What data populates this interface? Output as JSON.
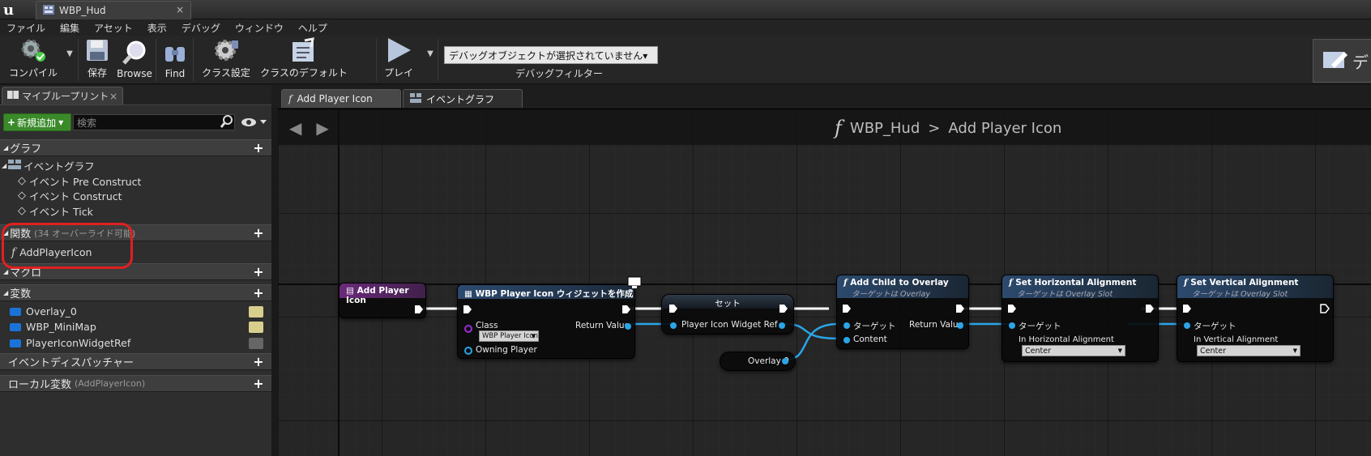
{
  "app": {
    "logo": "u",
    "doc_tab": "WBP_Hud",
    "doc_tab_close": "×"
  },
  "menu": [
    "ファイル",
    "編集",
    "アセット",
    "表示",
    "デバッグ",
    "ウィンドウ",
    "ヘルプ"
  ],
  "toolbar": {
    "compile": "コンパイル",
    "save": "保存",
    "browse": "Browse",
    "find": "Find",
    "class_settings": "クラス設定",
    "class_defaults": "クラスのデフォルト",
    "play": "プレイ",
    "debug_object": "デバッグオブジェクトが選択されていません▾",
    "debug_filter": "デバッグフィルター",
    "right_button": "デ"
  },
  "left_panel": {
    "tab": "マイブループリント",
    "add_new": "新規追加",
    "search_placeholder": "検索",
    "sections": {
      "graphs": "グラフ",
      "functions": "関数",
      "functions_hint": "(34 オーバーライド可能)",
      "macros": "マクロ",
      "variables": "変数",
      "dispatchers": "イベントディスパッチャー",
      "local_vars": "ローカル変数",
      "local_vars_hint": "(AddPlayerIcon)"
    },
    "event_graph": "イベントグラフ",
    "events": [
      "イベント Pre Construct",
      "イベント Construct",
      "イベント Tick"
    ],
    "functions": [
      "AddPlayerIcon"
    ],
    "variables": [
      "Overlay_0",
      "WBP_MiniMap",
      "PlayerIconWidgetRef"
    ]
  },
  "graph_tabs": [
    "Add Player Icon",
    "イベントグラフ"
  ],
  "breadcrumb": {
    "root": "WBP_Hud",
    "sep": ">",
    "current": "Add Player Icon"
  },
  "nodes": {
    "entry": {
      "title": "Add Player Icon"
    },
    "create": {
      "title": "WBP Player Icon ウィジェットを作成",
      "class_label": "Class",
      "class_value": "WBP Player Icon",
      "owning_player": "Owning Player",
      "return_value": "Return Value"
    },
    "set": {
      "title": "セット",
      "pin": "Player Icon Widget Ref"
    },
    "overlay_get": {
      "title": "Overlay 0"
    },
    "add_child": {
      "title": "Add Child to Overlay",
      "subtitle": "ターゲットは Overlay",
      "target": "ターゲット",
      "content": "Content",
      "return_value": "Return Value"
    },
    "set_h": {
      "title": "Set Horizontal Alignment",
      "subtitle": "ターゲットは Overlay Slot",
      "target": "ターゲット",
      "param": "In Horizontal Alignment",
      "value": "Center"
    },
    "set_v": {
      "title": "Set Vertical Alignment",
      "subtitle": "ターゲットは Overlay Slot",
      "target": "ターゲット",
      "param": "In Vertical Alignment",
      "value": "Center"
    }
  }
}
